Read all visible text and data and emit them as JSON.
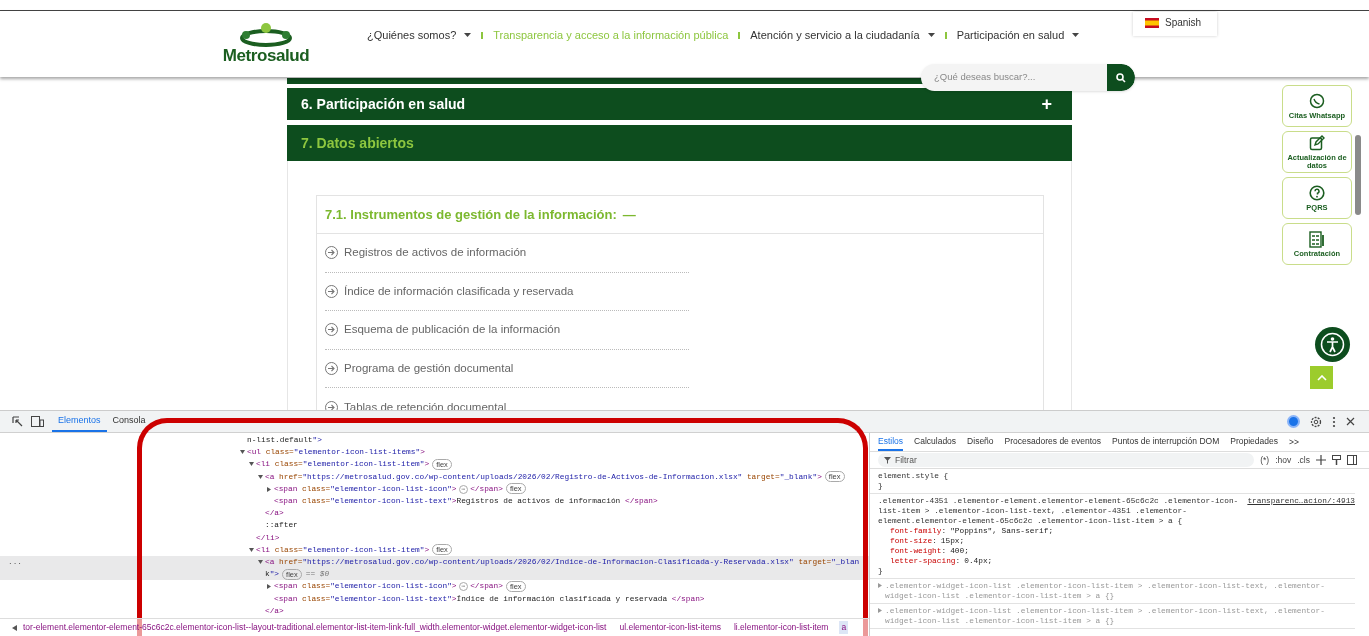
{
  "header": {
    "logo": "Metrosalud",
    "nav": [
      {
        "label": "¿Quiénes somos?",
        "selected": false,
        "dropdown": true
      },
      {
        "label": "Transparencia y acceso a la información pública",
        "selected": true,
        "dropdown": false
      },
      {
        "label": "Atención y servicio a la ciudadanía",
        "selected": false,
        "dropdown": true
      },
      {
        "label": "Participación en salud",
        "selected": false,
        "dropdown": true
      }
    ],
    "language": "Spanish",
    "search": {
      "placeholder": "¿Qué deseas buscar?..."
    }
  },
  "accordion": [
    {
      "title": "6. Participación en salud",
      "expanded": false,
      "toggle": "+"
    },
    {
      "title": "7. Datos abiertos",
      "expanded": true
    }
  ],
  "section": {
    "title": "7.1. Instrumentos de gestión de la información:",
    "toggle": "—",
    "items": [
      "Registros de activos de información",
      "Índice de información clasificada y reservada",
      "Esquema de publicación de la información",
      "Programa de gestión documental",
      "Tablas de retención documental"
    ]
  },
  "float_buttons": [
    {
      "label": "Citas Whatsapp",
      "kind": "chat"
    },
    {
      "label": "Actualización de datos",
      "kind": "edit"
    },
    {
      "label": "PQRS",
      "kind": "help"
    },
    {
      "label": "Contratación",
      "kind": "form"
    }
  ],
  "devtools": {
    "tabs": [
      {
        "label": "Elementos",
        "selected": true
      },
      {
        "label": "Consola",
        "selected": false
      }
    ],
    "dom_tree": [
      {
        "text": "n-list.default\">"
      },
      {
        "text": "<ul class=\"elementor-icon-list-items\">",
        "expanded": true,
        "children": [
          {
            "text": "<li class=\"elementor-icon-list-item\">",
            "badge": "flex",
            "expanded": true,
            "children": [
              {
                "text": "<a href=\"https://metrosalud.gov.co/wp-content/uploads/2026/02/Registro-de-Activos-de-Informacion.xlsx\" target=\"_blank\">",
                "badge": "flex",
                "expanded": true,
                "children": [
                  {
                    "text": "<span class=\"elementor-icon-list-icon\">",
                    "ellipsis": "⋯",
                    "after": "</span>",
                    "badge": "flex",
                    "expanded": false
                  },
                  {
                    "text": "<span class=\"elementor-icon-list-text\">Registros de activos de información </span>"
                  }
                ],
                "close": "</a>"
              },
              {
                "text": "::after"
              }
            ],
            "close": "</li>"
          },
          {
            "text": "<li class=\"elementor-icon-list-item\">",
            "badge": "flex",
            "expanded": true,
            "children": [
              {
                "text": "<a href=\"https://metrosalud.gov.co/wp-content/uploads/2026/02/Indice-de-Informacion-Clasificada-y-Reservada.xlsx\" target=\"_blan",
                "wrap": "k\">",
                "badge": "flex",
                "selected": true,
                "marker": "== $0",
                "gutter": "...",
                "expanded": true,
                "children": [
                  {
                    "text": "<span class=\"elementor-icon-list-icon\">",
                    "ellipsis": "⋯",
                    "after": "</span>",
                    "badge": "flex",
                    "expanded": false
                  },
                  {
                    "text": "<span class=\"elementor-icon-list-text\">Índice de información clasificada y reservada </span>"
                  }
                ],
                "close": "</a>"
              }
            ]
          }
        ]
      }
    ],
    "breadcrumb": [
      {
        "label": "tor-element.elementor-element-65c6c2c.elementor-icon-list--layout-traditional.elementor-list-item-link-full_width.elementor-widget.elementor-widget-icon-list",
        "selected": false
      },
      {
        "label": "ul.elementor-icon-list-items",
        "selected": false
      },
      {
        "label": "li.elementor-icon-list-item",
        "selected": false
      },
      {
        "label": "a",
        "selected": true
      }
    ],
    "pane_tabs": [
      {
        "label": "Estilos",
        "selected": true
      },
      {
        "label": "Calculados",
        "selected": false
      },
      {
        "label": "Diseño",
        "selected": false
      },
      {
        "label": "Procesadores de eventos",
        "selected": false
      },
      {
        "label": "Puntos de interrupción DOM",
        "selected": false
      },
      {
        "label": "Propiedades",
        "selected": false
      }
    ],
    "more_tabs": ">>",
    "filter": {
      "placeholder": "Filtrar"
    },
    "filter_tools": [
      "(*)",
      ":hov",
      ".cls"
    ],
    "rules": [
      {
        "selector": "element.style {",
        "close": "}",
        "dimmed": false
      },
      {
        "selector": ".elementor-4351 .elementor-element.elementor-element-65c6c2c .elementor-icon-list-item > .elementor-icon-list-text, .elementor-4351 .elementor-element.elementor-element-65c6c2c .elementor-icon-list-item > a {",
        "source": "transparenc…acion/:4913",
        "close": "}",
        "dimmed": false,
        "declarations": [
          {
            "property": "font-family",
            "colon": ":",
            "value": "\"Poppins\", Sans-serif;"
          },
          {
            "property": "font-size",
            "colon": ":",
            "value": "15px;"
          },
          {
            "property": "font-weight",
            "colon": ":",
            "value": "400;"
          },
          {
            "property": "letter-spacing",
            "colon": ":",
            "value": "0.4px;"
          }
        ]
      },
      {
        "selector": ".elementor-widget-icon-list .elementor-icon-list-item > .elementor-icon-list-text, .elementor-widget-icon-list .elementor-icon-list-item > a {}",
        "dimmed": true
      },
      {
        "selector": ".elementor-widget-icon-list .elementor-icon-list-item > .elementor-icon-list-text, .elementor-widget-icon-list .elementor-icon-list-item > a {}",
        "dimmed": true
      }
    ]
  }
}
